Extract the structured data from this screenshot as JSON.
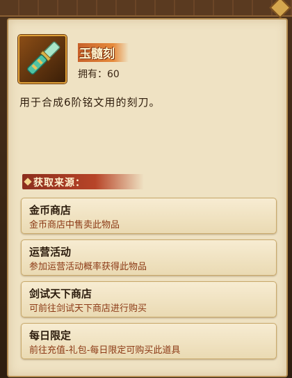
{
  "item": {
    "name": "玉髓刻",
    "owned_label": "拥有：",
    "owned_count": "60",
    "description": "用于合成6阶铭文用的刻刀。",
    "icon": "carving-knife-icon"
  },
  "sources_header": "获取来源：",
  "sources": [
    {
      "title": "金币商店",
      "subtitle": "金币商店中售卖此物品"
    },
    {
      "title": "运营活动",
      "subtitle": "参加运营活动概率获得此物品"
    },
    {
      "title": "剑试天下商店",
      "subtitle": "可前往剑试天下商店进行购买"
    },
    {
      "title": "每日限定",
      "subtitle": "前往充值-礼包-每日限定可购买此道具"
    }
  ],
  "colors": {
    "panel": "#efe2c3",
    "accent": "#c8612a",
    "subtext": "#8c3a16"
  }
}
